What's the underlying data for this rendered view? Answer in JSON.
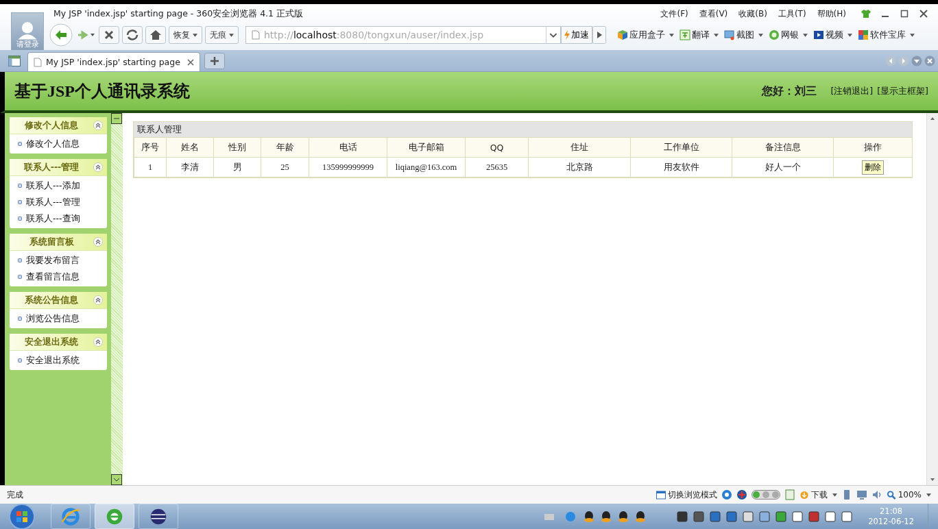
{
  "browser": {
    "title": "My JSP 'index.jsp' starting page - 360安全浏览器 4.1 正式版",
    "avatar_label": "请登录",
    "menu": [
      "文件(F)",
      "查看(V)",
      "收藏(B)",
      "工具(T)",
      "帮助(H)"
    ],
    "nav_buttons": [
      {
        "label": "恢复"
      },
      {
        "label": "无痕"
      }
    ],
    "url": {
      "scheme": "http://",
      "host": "localhost",
      "path": ":8080/tongxun/auser/index.jsp"
    },
    "speed_label": "加速",
    "tools": [
      {
        "kind": "box",
        "label": "应用盒子"
      },
      {
        "kind": "translate",
        "label": "翻译"
      },
      {
        "kind": "screenshot",
        "label": "截图"
      },
      {
        "kind": "bank",
        "label": "网银"
      },
      {
        "kind": "video",
        "label": "视频"
      },
      {
        "kind": "software",
        "label": "软件宝库"
      }
    ],
    "tabs": [
      {
        "title": "My JSP 'index.jsp' starting page",
        "selected": true
      }
    ]
  },
  "page": {
    "title": "基于JSP个人通讯录系统",
    "greeting": "您好：刘三",
    "links": [
      "[注销退出]",
      "[显示主框架]"
    ]
  },
  "sidebar": [
    {
      "title": "修改个人信息",
      "expanded": true,
      "items": [
        "修改个人信息"
      ]
    },
    {
      "title": "联系人---管理",
      "expanded": true,
      "items": [
        "联系人---添加",
        "联系人---管理",
        "联系人---查询"
      ]
    },
    {
      "title": "系统留言板",
      "expanded": true,
      "items": [
        "我要发布留言",
        "查看留言信息"
      ]
    },
    {
      "title": "系统公告信息",
      "expanded": true,
      "items": [
        "浏览公告信息"
      ]
    },
    {
      "title": "安全退出系统",
      "expanded": true,
      "items": [
        "安全退出系统"
      ]
    }
  ],
  "panel": {
    "title": "联系人管理",
    "columns": [
      "序号",
      "姓名",
      "性别",
      "年龄",
      "电话",
      "电子邮箱",
      "QQ",
      "住址",
      "工作单位",
      "备注信息",
      "操作"
    ],
    "rows": [
      {
        "cells": [
          "1",
          "李清",
          "男",
          "25",
          "135999999999",
          "liqiang@163.com",
          "25635",
          "北京路",
          "用友软件",
          "好人一个"
        ],
        "action": "删除"
      }
    ]
  },
  "status_bar": {
    "text": "完成",
    "mode": "切换浏览模式",
    "download": "下载",
    "zoom": "100%"
  },
  "taskbar": {
    "time": "21:08",
    "date": "2012-06-12"
  }
}
